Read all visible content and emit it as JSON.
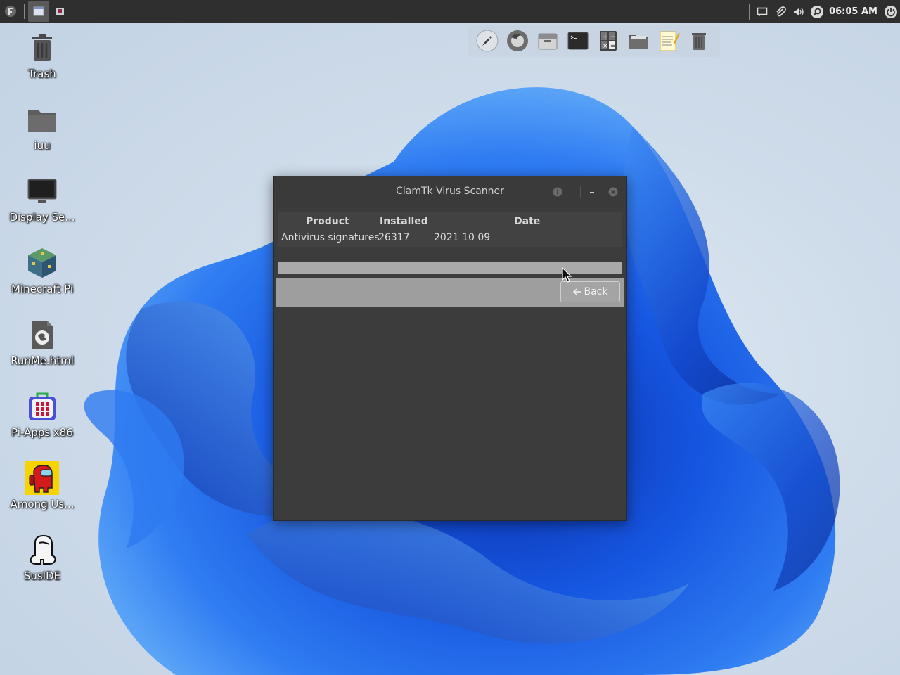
{
  "taskbar": {
    "clock": "06:05 AM"
  },
  "desktop_icons": [
    {
      "label": "Trash",
      "icon": "trash-icon"
    },
    {
      "label": "iuu",
      "icon": "folder-icon"
    },
    {
      "label": "Display Se...",
      "icon": "display-icon"
    },
    {
      "label": "Minecraft Pi",
      "icon": "minecraft-icon"
    },
    {
      "label": "RunMe.html",
      "icon": "html-file-icon"
    },
    {
      "label": "Pi-Apps x86",
      "icon": "pi-apps-icon"
    },
    {
      "label": "Among Us...",
      "icon": "among-us-icon"
    },
    {
      "label": "SusIDE",
      "icon": "suside-icon"
    }
  ],
  "dock": {
    "items": [
      "rocket-icon",
      "firefox-icon",
      "file-archive-icon",
      "terminal-icon",
      "calculator-icon",
      "file-manager-icon",
      "text-editor-icon",
      "trash-icon"
    ]
  },
  "window": {
    "title": "ClamTk Virus Scanner",
    "table": {
      "headers": [
        "Product",
        "Installed",
        "Date"
      ],
      "rows": [
        [
          "Antivirus signatures",
          "26317",
          "2021 10 09"
        ]
      ]
    },
    "back_label": "Back"
  },
  "colors": {
    "window_bg": "#3c3c3c",
    "panel_bg": "#2f2f2f",
    "progress": "#a9a9a9",
    "bottom_bar": "#9e9e9e"
  }
}
